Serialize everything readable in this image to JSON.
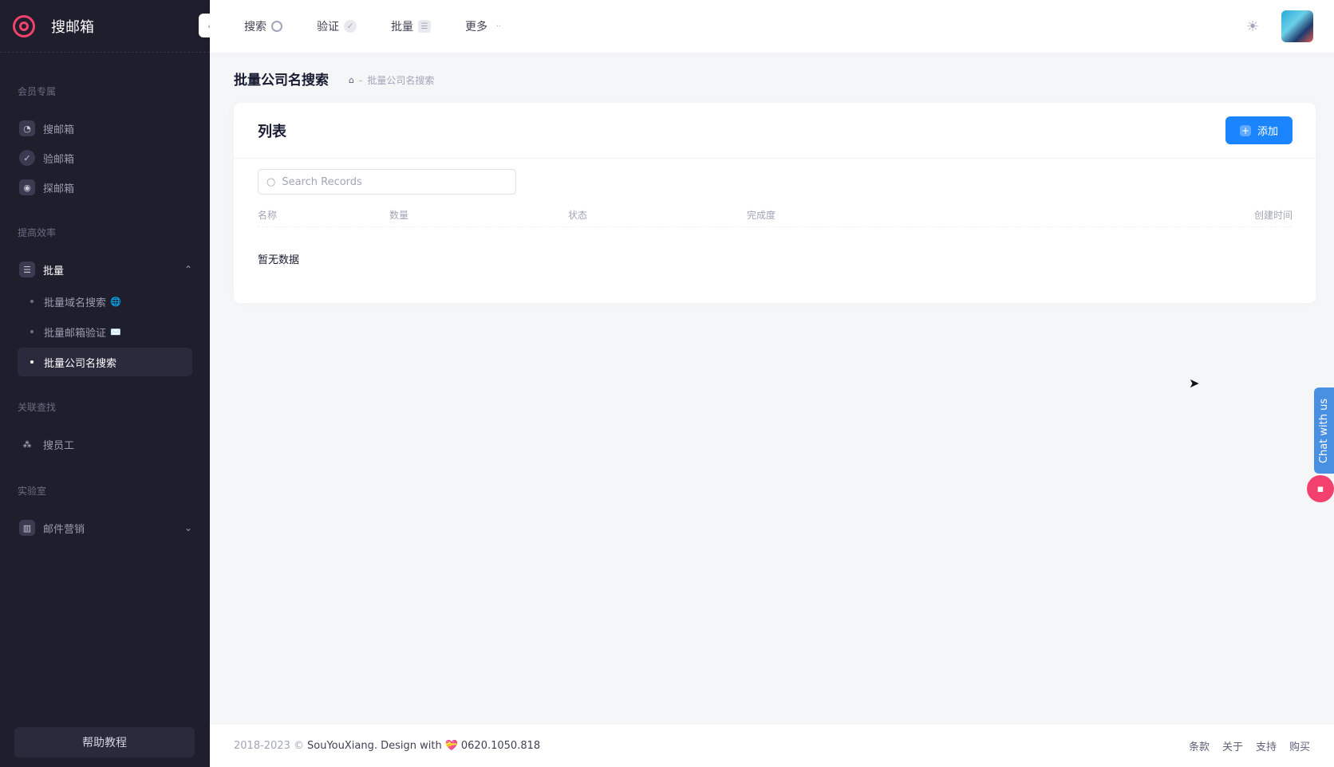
{
  "app": {
    "logo_text": "搜邮箱"
  },
  "sidebar": {
    "sections": [
      {
        "title": "会员专属"
      },
      {
        "title": "提高效率"
      },
      {
        "title": "关联查找"
      },
      {
        "title": "实验室"
      }
    ],
    "items": [
      {
        "label": "搜邮箱",
        "icon": "search-mail-icon"
      },
      {
        "label": "验邮箱",
        "icon": "check-icon"
      },
      {
        "label": "探邮箱",
        "icon": "scan-icon"
      },
      {
        "label": "批量",
        "icon": "list-icon"
      },
      {
        "label": "搜员工",
        "icon": "people-icon"
      },
      {
        "label": "邮件营销",
        "icon": "chart-icon"
      }
    ],
    "sub_items": [
      {
        "label": "批量域名搜索",
        "badge": "🌐"
      },
      {
        "label": "批量邮箱验证",
        "badge": "✉️"
      },
      {
        "label": "批量公司名搜索",
        "badge": ""
      }
    ],
    "help_label": "帮助教程"
  },
  "header": {
    "nav": [
      {
        "label": "搜索",
        "icon": "search-icon"
      },
      {
        "label": "验证",
        "icon": "check-icon"
      },
      {
        "label": "批量",
        "icon": "list-icon"
      },
      {
        "label": "更多",
        "icon": "dots-icon"
      }
    ]
  },
  "page": {
    "title": "批量公司名搜索",
    "breadcrumb": {
      "separator": "-",
      "current": "批量公司名搜索"
    }
  },
  "card": {
    "title": "列表",
    "add_label": "添加",
    "search_placeholder": "Search Records",
    "columns": [
      "名称",
      "数量",
      "状态",
      "完成度",
      "创建时间"
    ],
    "empty_text": "暂无数据"
  },
  "footer": {
    "copyright": "2018-2023 ©",
    "brand": "SouYouXiang. Design with",
    "heart": "💝",
    "phone": "0620.1050.818",
    "links": [
      "条款",
      "关于",
      "支持",
      "购买"
    ]
  },
  "chat": {
    "tab_label": "Chat with us"
  },
  "colors": {
    "sidebar_bg": "#1e1e2d",
    "primary": "#1b84ff",
    "accent": "#f1416c"
  }
}
